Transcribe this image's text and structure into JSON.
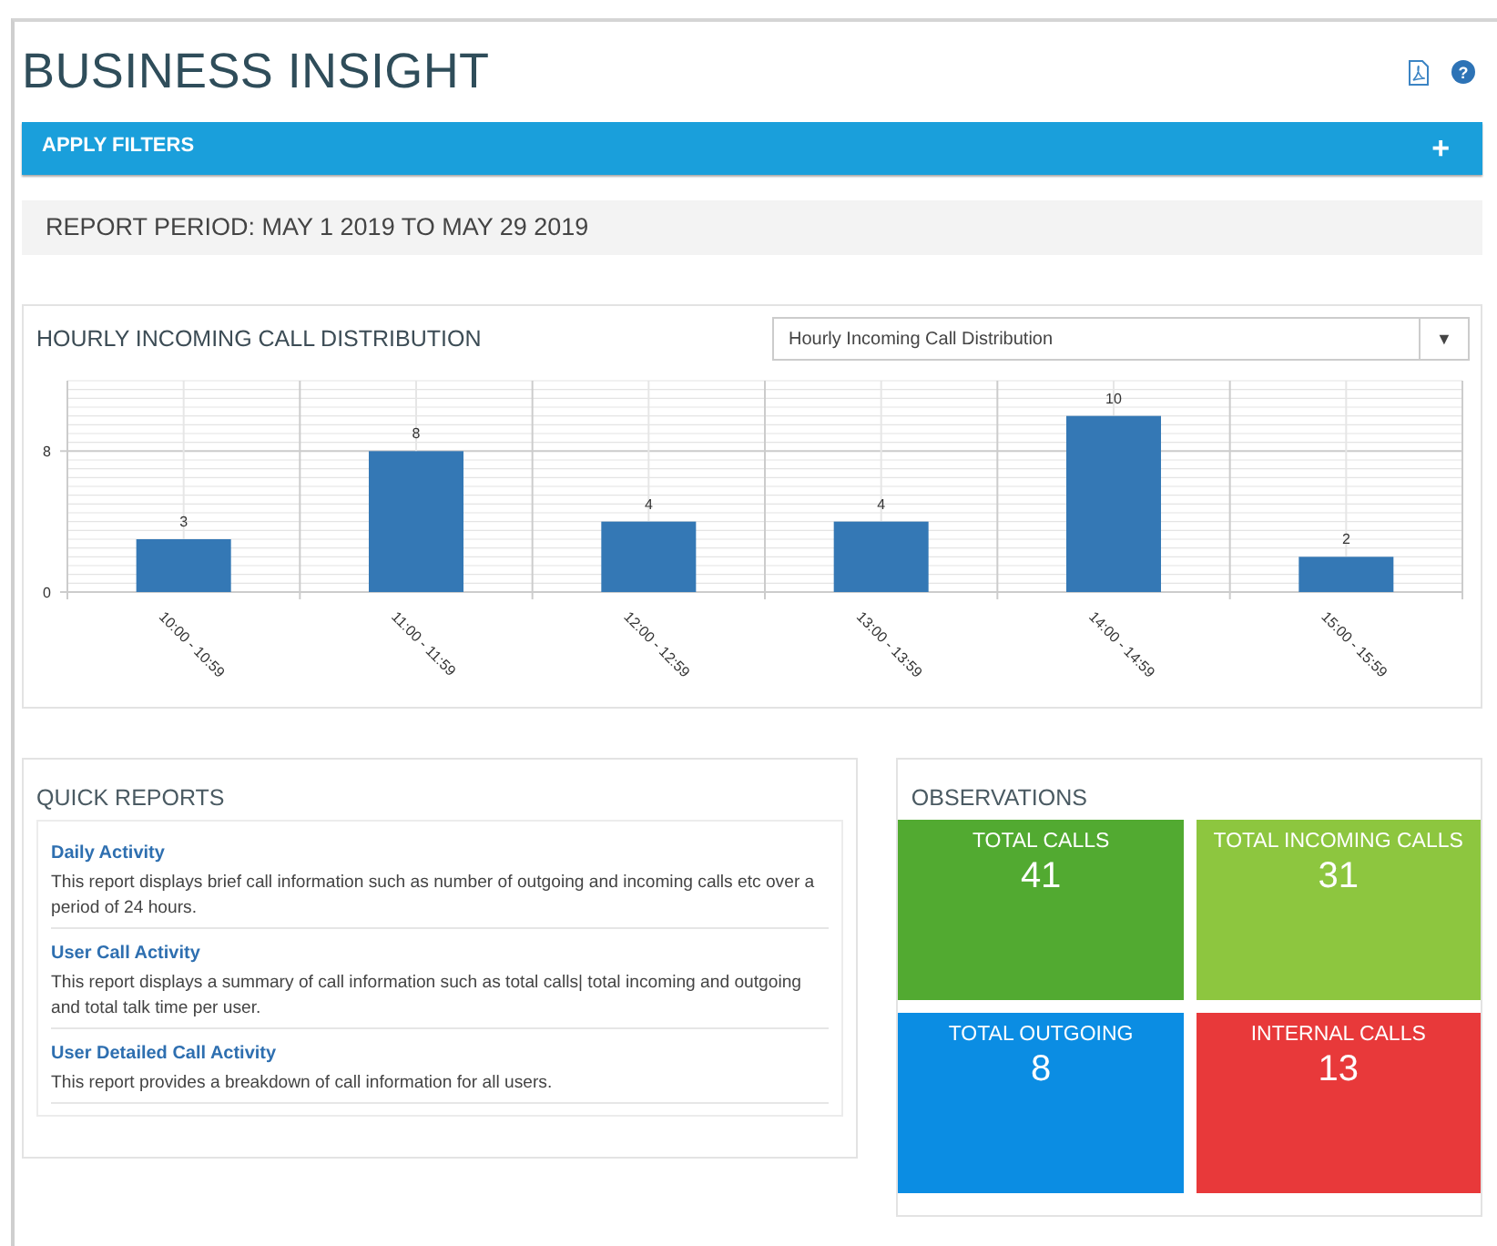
{
  "header": {
    "title": "BUSINESS INSIGHT",
    "help_button": "?"
  },
  "filters": {
    "label": "APPLY FILTERS",
    "expand_button": "+"
  },
  "report_period": "REPORT PERIOD: MAY 1 2019 TO MAY 29 2019",
  "chart_panel": {
    "title": "HOURLY INCOMING CALL DISTRIBUTION",
    "dropdown": {
      "value": "Hourly Incoming Call Distribution",
      "arrow": "▼"
    },
    "chart_data": {
      "type": "bar",
      "categories": [
        "10:00 - 10:59",
        "11:00 - 11:59",
        "12:00 - 12:59",
        "13:00 - 13:59",
        "14:00 - 14:59",
        "15:00 - 15:59"
      ],
      "values": [
        3,
        8,
        4,
        4,
        10,
        2
      ],
      "ylim": [
        0,
        12
      ],
      "yticks": [
        0,
        8
      ],
      "data_labels": true
    }
  },
  "quick_reports": {
    "title": "QUICK REPORTS",
    "items": [
      {
        "name": "Daily Activity",
        "description": "This report displays brief call information such as number of outgoing and incoming calls etc over a period of 24 hours."
      },
      {
        "name": "User Call Activity",
        "description": "This report displays a summary of call information such as total calls| total incoming and outgoing and total talk time per user."
      },
      {
        "name": "User Detailed Call Activity",
        "description": "This report provides a breakdown of call information for all users."
      }
    ]
  },
  "observations": {
    "title": "OBSERVATIONS",
    "tiles": [
      {
        "label": "TOTAL CALLS",
        "value": "41",
        "color": "#52aa31"
      },
      {
        "label": "TOTAL INCOMING CALLS",
        "value": "31",
        "color": "#8dc63f"
      },
      {
        "label": "TOTAL OUTGOING",
        "value": "8",
        "color": "#0b8de3"
      },
      {
        "label": "INTERNAL CALLS",
        "value": "13",
        "color": "#e8393a"
      }
    ]
  }
}
